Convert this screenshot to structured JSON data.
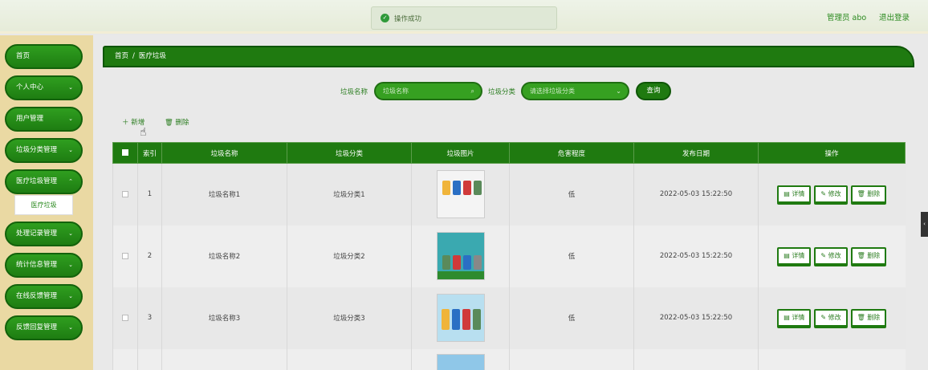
{
  "header": {
    "toast": "操作成功",
    "admin": "管理员 abo",
    "logout": "退出登录"
  },
  "sidebar": {
    "items": [
      {
        "label": "首页"
      },
      {
        "label": "个人中心"
      },
      {
        "label": "用户管理"
      },
      {
        "label": "垃圾分类管理"
      },
      {
        "label": "医疗垃圾管理"
      },
      {
        "label": "处理记录管理"
      },
      {
        "label": "统计信息管理"
      },
      {
        "label": "在线反馈管理"
      },
      {
        "label": "反馈回复管理"
      }
    ],
    "submenu": "医疗垃圾"
  },
  "breadcrumb": {
    "home": "首页",
    "separator": "/",
    "current": "医疗垃圾"
  },
  "search": {
    "name_label": "垃圾名称",
    "name_placeholder": "垃圾名称",
    "cat_label": "垃圾分类",
    "cat_placeholder": "请选择垃圾分类",
    "button": "查询"
  },
  "actions": {
    "add": "新增",
    "delete": "删除"
  },
  "table": {
    "headers": [
      "索引",
      "垃圾名称",
      "垃圾分类",
      "垃圾图片",
      "危害程度",
      "发布日期",
      "操作"
    ],
    "rows": [
      {
        "index": "1",
        "name": "垃圾名称1",
        "category": "垃圾分类1",
        "level": "低",
        "date": "2022-05-03 15:22:50"
      },
      {
        "index": "2",
        "name": "垃圾名称2",
        "category": "垃圾分类2",
        "level": "低",
        "date": "2022-05-03 15:22:50"
      },
      {
        "index": "3",
        "name": "垃圾名称3",
        "category": "垃圾分类3",
        "level": "低",
        "date": "2022-05-03 15:22:50"
      }
    ],
    "row_buttons": {
      "detail": "详情",
      "edit": "修改",
      "delete": "删除"
    }
  },
  "colors": {
    "primary": "#1f7a10",
    "sidebar_bg": "#ead9a3",
    "accent_text": "#2b7d20"
  }
}
